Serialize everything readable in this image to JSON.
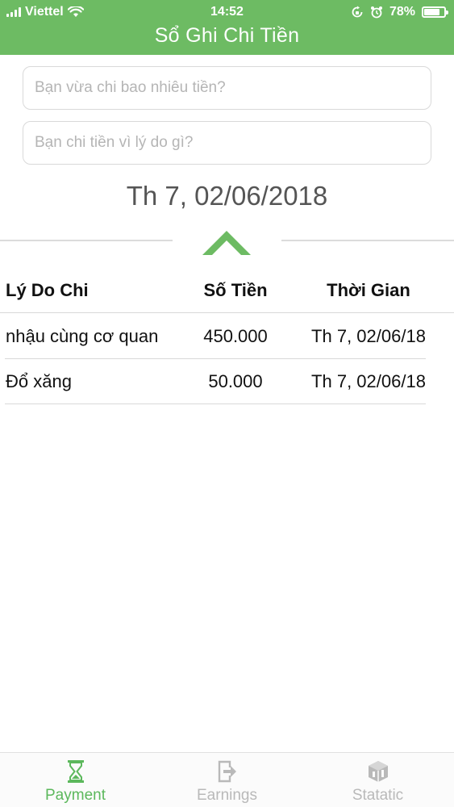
{
  "status_bar": {
    "carrier": "Viettel",
    "time": "14:52",
    "battery": "78%",
    "battery_level": 0.78
  },
  "header": {
    "title": "Sổ Ghi Chi Tiền"
  },
  "form": {
    "amount_placeholder": "Bạn vừa chi bao nhiêu tiền?",
    "reason_placeholder": "Bạn chi tiền vì lý do gì?"
  },
  "date_label": "Th 7, 02/06/2018",
  "table": {
    "headers": [
      "Lý Do Chi",
      "Số Tiền",
      "Thời Gian"
    ],
    "rows": [
      {
        "reason": "nhậu cùng cơ quan",
        "amount": "450.000",
        "time": "Th 7, 02/06/18"
      },
      {
        "reason": "Đổ xăng",
        "amount": "50.000",
        "time": "Th 7, 02/06/18"
      }
    ]
  },
  "tabs": [
    {
      "label": "Payment",
      "icon": "hourglass-icon",
      "active": true
    },
    {
      "label": "Earnings",
      "icon": "exit-icon",
      "active": false
    },
    {
      "label": "Statatic",
      "icon": "cube-icon",
      "active": false
    }
  ],
  "colors": {
    "accent": "#6dbb63",
    "inactive": "#b9b9b9"
  }
}
